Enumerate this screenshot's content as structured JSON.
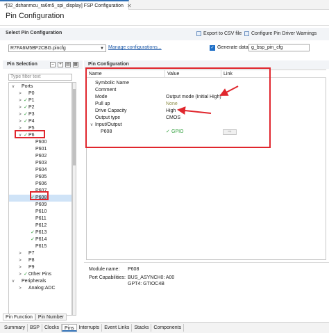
{
  "tab": {
    "title": "*[02_dshanmcu_ra6m5_spi_display] FSP Configuration",
    "close": "✕"
  },
  "page_title": "Pin Configuration",
  "select_section": {
    "label": "Select Pin Configuration",
    "export_label": "Export to CSV file",
    "warnings_label": "Configure Pin Driver Warnings",
    "combo_value": "R7FA6M5BF2CBG.pincfg",
    "manage_link": "Manage configurations...",
    "generate_label": "Generate data:",
    "generate_value": "g_bsp_pin_cfg"
  },
  "pin_selection": {
    "title": "Pin Selection",
    "filter_placeholder": "Type filter text",
    "tree": [
      {
        "label": "Ports",
        "chev": "v",
        "check": "",
        "indent": 0
      },
      {
        "label": "P0",
        "chev": ">",
        "check": "",
        "indent": 1
      },
      {
        "label": "P1",
        "chev": ">",
        "check": "✓",
        "indent": 1
      },
      {
        "label": "P2",
        "chev": ">",
        "check": "✓",
        "indent": 1
      },
      {
        "label": "P3",
        "chev": ">",
        "check": "✓",
        "indent": 1
      },
      {
        "label": "P4",
        "chev": ">",
        "check": "✓",
        "indent": 1
      },
      {
        "label": "P5",
        "chev": ">",
        "check": "",
        "indent": 1
      },
      {
        "label": "P6",
        "chev": "v",
        "check": "✓",
        "indent": 1
      },
      {
        "label": "P600",
        "chev": "",
        "check": "",
        "indent": 2
      },
      {
        "label": "P601",
        "chev": "",
        "check": "",
        "indent": 2
      },
      {
        "label": "P602",
        "chev": "",
        "check": "",
        "indent": 2
      },
      {
        "label": "P603",
        "chev": "",
        "check": "",
        "indent": 2
      },
      {
        "label": "P604",
        "chev": "",
        "check": "",
        "indent": 2
      },
      {
        "label": "P605",
        "chev": "",
        "check": "",
        "indent": 2
      },
      {
        "label": "P606",
        "chev": "",
        "check": "",
        "indent": 2
      },
      {
        "label": "P607",
        "chev": "",
        "check": "",
        "indent": 2
      },
      {
        "label": "P608",
        "chev": "",
        "check": "✓",
        "indent": 2,
        "selected": true
      },
      {
        "label": "P609",
        "chev": "",
        "check": "",
        "indent": 2
      },
      {
        "label": "P610",
        "chev": "",
        "check": "",
        "indent": 2
      },
      {
        "label": "P611",
        "chev": "",
        "check": "",
        "indent": 2
      },
      {
        "label": "P612",
        "chev": "",
        "check": "",
        "indent": 2
      },
      {
        "label": "P613",
        "chev": "",
        "check": "✓",
        "indent": 2
      },
      {
        "label": "P614",
        "chev": "",
        "check": "✓",
        "indent": 2
      },
      {
        "label": "P615",
        "chev": "",
        "check": "",
        "indent": 2
      },
      {
        "label": "P7",
        "chev": ">",
        "check": "",
        "indent": 1
      },
      {
        "label": "P8",
        "chev": ">",
        "check": "",
        "indent": 1
      },
      {
        "label": "P9",
        "chev": ">",
        "check": "",
        "indent": 1
      },
      {
        "label": "Other Pins",
        "chev": ">",
        "check": "✓",
        "indent": 1
      },
      {
        "label": "Peripherals",
        "chev": "v",
        "check": "",
        "indent": 0
      },
      {
        "label": "Analog:ADC",
        "chev": ">",
        "check": "",
        "indent": 1
      }
    ],
    "tabs": [
      "Pin Function",
      "Pin Number"
    ]
  },
  "pin_config": {
    "title": "Pin Configuration",
    "columns": [
      "Name",
      "Value",
      "Link"
    ],
    "rows": [
      {
        "name": "Symbolic Name",
        "value": "",
        "style": ""
      },
      {
        "name": "Comment",
        "value": "",
        "style": ""
      },
      {
        "name": "Mode",
        "value": "Output mode (Initial High)",
        "style": ""
      },
      {
        "name": "Pull up",
        "value": "None",
        "style": "gray"
      },
      {
        "name": "Drive Capacity",
        "value": "High",
        "style": ""
      },
      {
        "name": "Output type",
        "value": "CMOS",
        "style": ""
      }
    ],
    "group": {
      "label": "Input/Output",
      "chev": "v"
    },
    "group_row": {
      "name": "P608",
      "check": "✓",
      "value": "GPIO",
      "link_glyph": "⇨"
    },
    "module_name_label": "Module name:",
    "module_name_value": "P608",
    "port_cap_label": "Port Capabilities:",
    "port_cap_value_1": "BUS_ASYNCH0: A00",
    "port_cap_value_2": "GPT4: GTIOC4B"
  },
  "footer_tabs": [
    "Summary",
    "BSP",
    "Clocks",
    "Pins",
    "Interrupts",
    "Event Links",
    "Stacks",
    "Components"
  ],
  "footer_active": "Pins",
  "colors": {
    "accent": "#2f6fb5",
    "annotation": "#e0262d",
    "check": "#2e9e3a"
  }
}
